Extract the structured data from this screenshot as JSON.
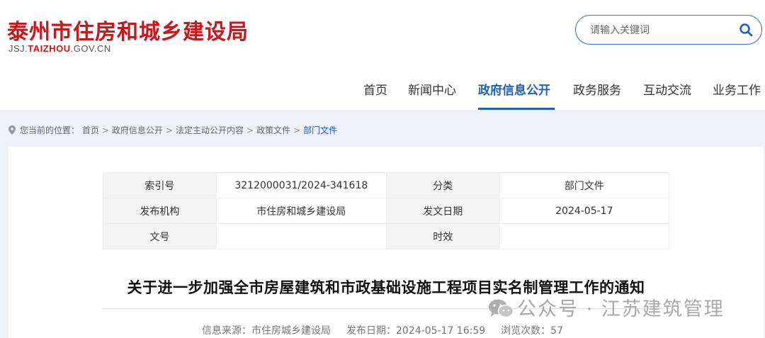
{
  "site": {
    "title": "泰州市住房和城乡建设局",
    "domain_prefix": "JSJ.",
    "domain_highlight": "TAIZHOU",
    "domain_suffix": ".GOV.CN"
  },
  "search": {
    "placeholder": "请输入关键词",
    "icon": "search-icon"
  },
  "nav": {
    "items": [
      {
        "label": "首页"
      },
      {
        "label": "新闻中心"
      },
      {
        "label": "政府信息公开"
      },
      {
        "label": "政务服务"
      },
      {
        "label": "互动交流"
      },
      {
        "label": "业务工作"
      }
    ],
    "active": "政府信息公开"
  },
  "breadcrumb": {
    "prefix": "您当前的位置：",
    "items": [
      "首页",
      "政府信息公开",
      "法定主动公开内容",
      "政策文件"
    ],
    "separator": ">",
    "current": "部门文件"
  },
  "meta": {
    "index_label": "索引号",
    "index_value": "3212000031/2024-341618",
    "category_label": "分类",
    "category_value": "部门文件",
    "publisher_label": "发布机构",
    "publisher_value": "市住房和城乡建设局",
    "date_label": "发文日期",
    "date_value": "2024-05-17",
    "docno_label": "文号",
    "docno_value": "",
    "validity_label": "时效",
    "validity_value": ""
  },
  "article": {
    "title": "关于进一步加强全市房屋建筑和市政基础设施工程项目实名制管理工作的通知",
    "source": "信息来源：市住房城乡建设局",
    "publish_date": "发布日期：2024-05-17 16:59",
    "views": "浏览次数：57"
  },
  "watermark": {
    "text": "公众号 · 江苏建筑管理"
  },
  "colors": {
    "brand_red": "#c8161d",
    "accent_blue": "#1d5fbf",
    "content_bg": "#eef2f7"
  }
}
